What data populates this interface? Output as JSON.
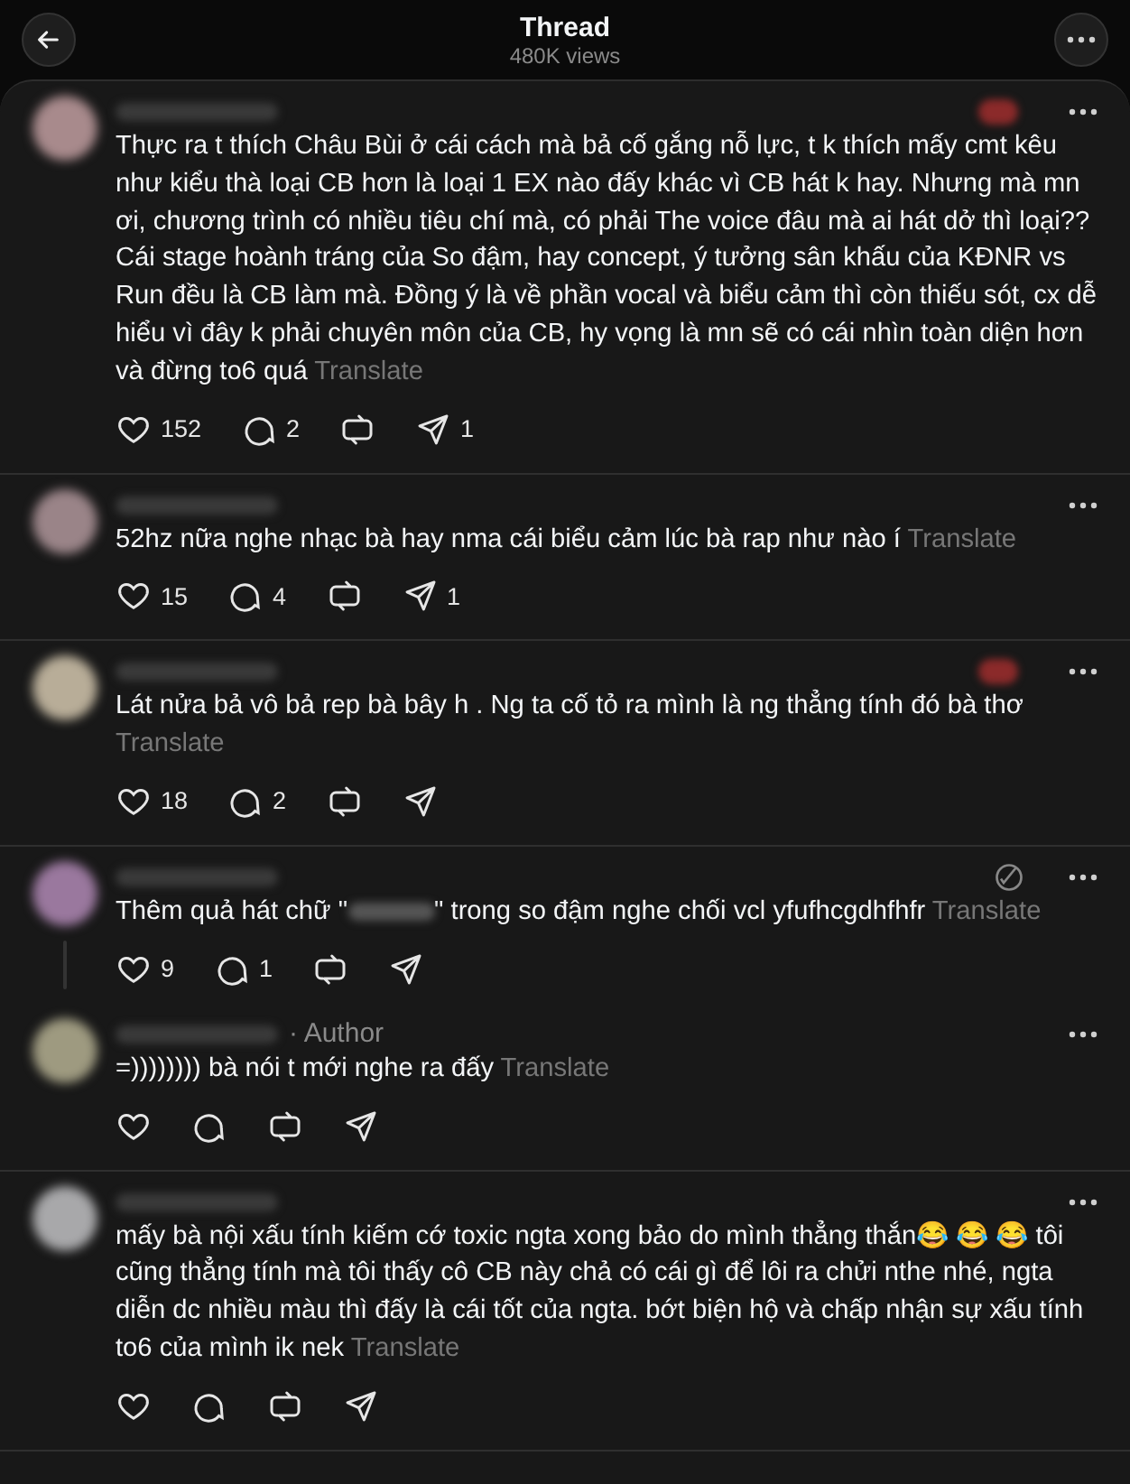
{
  "header": {
    "title": "Thread",
    "views": "480K views"
  },
  "posts": [
    {
      "color": "#a88a8c",
      "badge": true,
      "text": "Thực ra t thích Châu Bùi ở cái cách mà bả cố gắng nỗ lực, t k thích mấy cmt kêu như kiểu thà loại CB hơn là loại 1 EX nào đấy khác vì CB hát k hay. Nhưng mà mn ơi, chương trình có nhiều tiêu chí mà, có phải The voice đâu mà ai hát dở thì loại?? Cái stage hoành tráng của So đậm, hay concept, ý tưởng sân khấu của KĐNR vs Run đều là CB làm mà. Đồng ý là về phần vocal và biểu cảm thì còn thiếu sót, cx dễ hiểu vì đây k phải chuyên môn của CB, hy vọng là mn sẽ có cái nhìn toàn diện hơn và đừng to6 quá",
      "translate": "Translate",
      "likes": "152",
      "replies": "2",
      "shares": "1"
    },
    {
      "color": "#9a8488",
      "text": "52hz nữa nghe nhạc bà hay nma cái biểu cảm lúc bà rap như nào í",
      "translate": "Translate",
      "likes": "15",
      "replies": "4",
      "shares": "1"
    },
    {
      "color": "#b8ad98",
      "badge": true,
      "text": "Lát nửa bả vô bả rep bà bây h . Ng ta cố tỏ ra mình là ng thẳng tính đó bà thơ",
      "translate": "Translate",
      "likes": "18",
      "replies": "2"
    },
    {
      "color": "#9a789e",
      "threaded": true,
      "muted_icon": true,
      "text": "Thêm quả hát chữ \"",
      "text_after": "\" trong so đậm nghe chối vcl yfufhcgdhfhfr",
      "translate": "Translate",
      "likes": "9",
      "replies": "1"
    },
    {
      "color": "#9e9a80",
      "author": "· Author",
      "text": "=)))))))) bà nói t mới nghe ra đấy",
      "translate": "Translate"
    },
    {
      "color": "#a8a8aa",
      "text": "mấy bà nội xấu tính kiếm cớ toxic ngta xong bảo do mình thẳng thắn😂 😂 😂  tôi cũng thẳng tính mà tôi thấy cô CB này chả có cái gì để lôi ra chửi nthe nhé, ngta diễn dc nhiều màu thì đấy là cái tốt của ngta. bớt biện hộ và chấp nhận sự xấu tính to6 của mình ik nek",
      "translate": "Translate"
    }
  ]
}
